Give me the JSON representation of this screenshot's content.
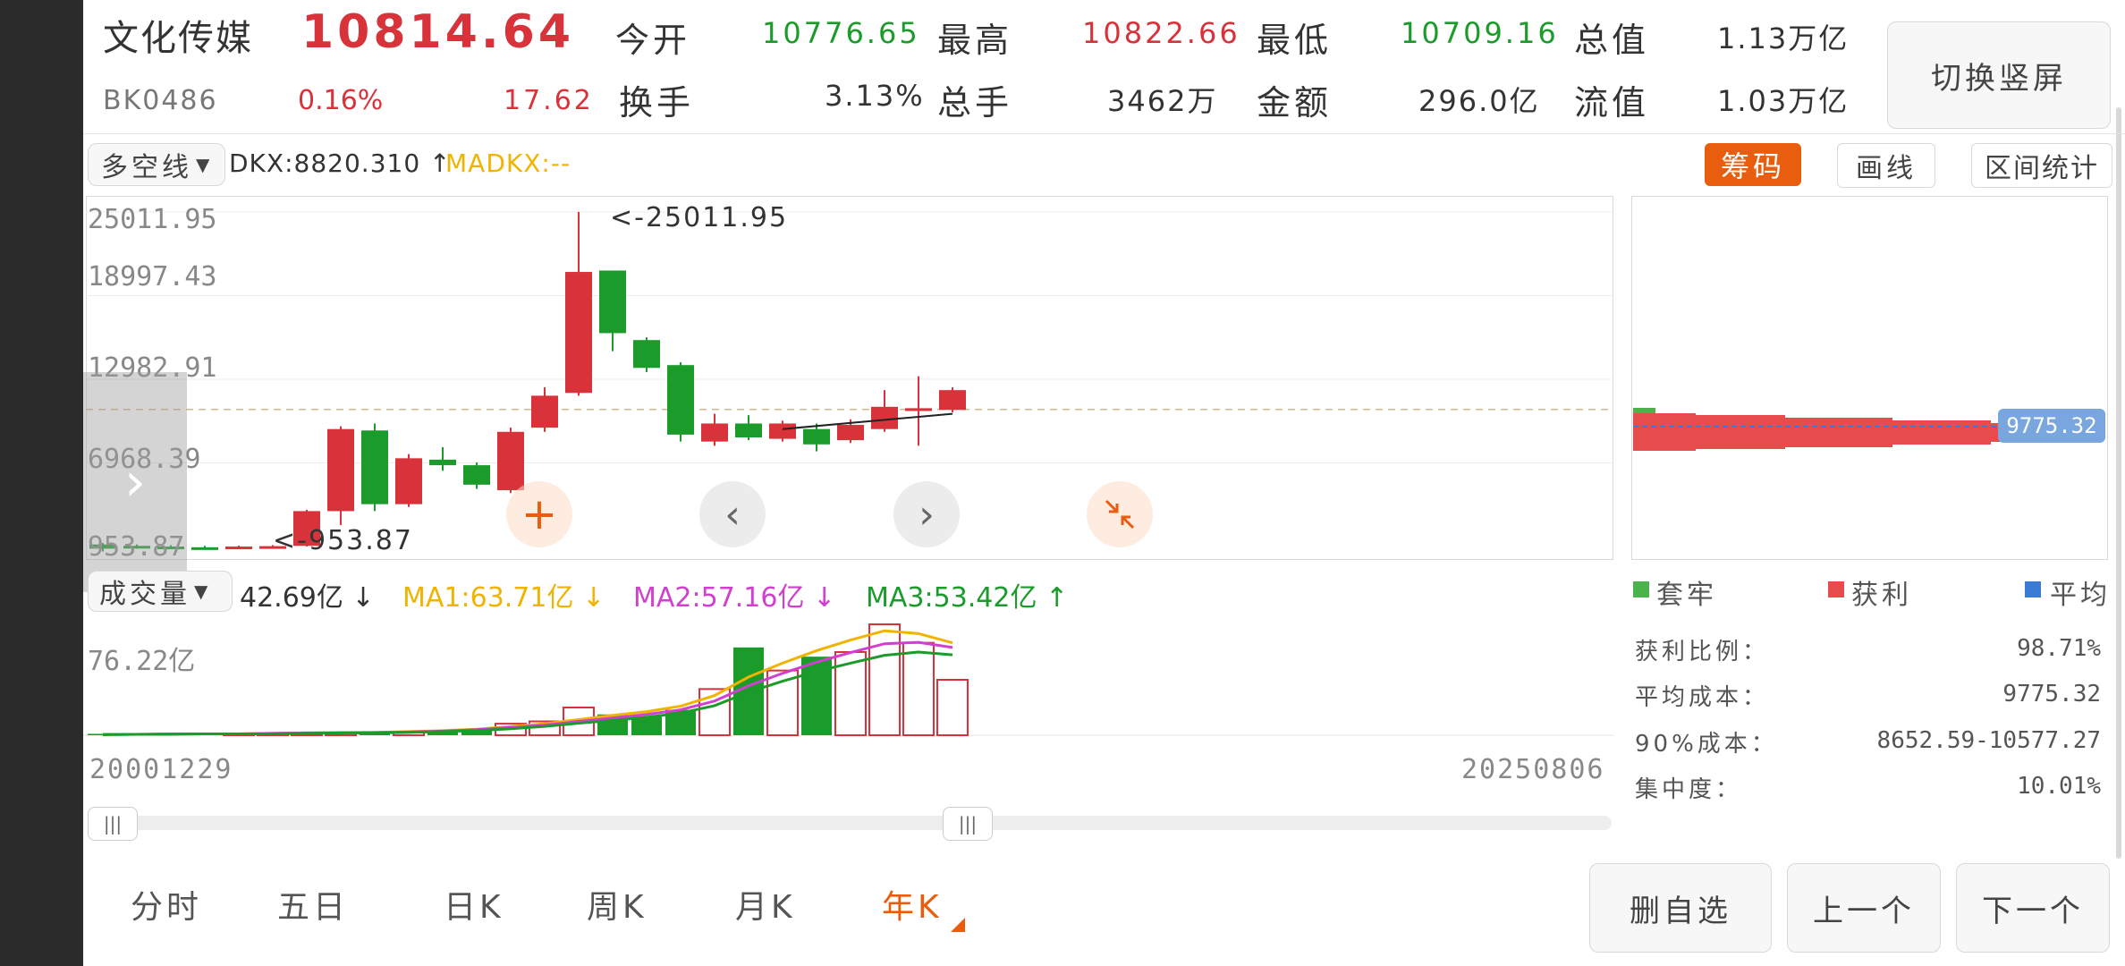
{
  "header": {
    "name": "文化传媒",
    "code": "BK0486",
    "price": "10814.64",
    "change_pct": "0.16%",
    "change": "17.62",
    "open_label": "今开",
    "open_value": "10776.65",
    "high_label": "最高",
    "high_value": "10822.66",
    "low_label": "最低",
    "low_value": "10709.16",
    "mktcap_label": "总值",
    "mktcap_value": "1.13万亿",
    "turnover_label": "换手",
    "turnover_value": "3.13%",
    "volume_label": "总手",
    "volume_value": "3462万",
    "amount_label": "金额",
    "amount_value": "296.0亿",
    "float_label": "流值",
    "float_value": "1.03万亿",
    "switch_button": "切换竖屏"
  },
  "indicator": {
    "selector": "多空线",
    "dkx": "DKX:8820.310 ↑",
    "madkx": "MADKX:--",
    "chip_button": "筹码",
    "draw_button": "画线",
    "range_button": "区间统计"
  },
  "price_axis": {
    "max_marker": "<-25011.95",
    "min_marker": "<-953.87",
    "ticks": [
      "25011.95",
      "18997.43",
      "12982.91",
      "6968.39",
      "953.87"
    ]
  },
  "volume": {
    "selector": "成交量",
    "value": "42.69亿 ↓",
    "ma1": "MA1:63.71亿 ↓",
    "ma2": "MA2:57.16亿 ↓",
    "ma3": "MA3:53.42亿 ↑",
    "axis_top": "76.22亿",
    "date_start": "20001229",
    "date_end": "20250806"
  },
  "chip": {
    "current_price_tag": "9775.32",
    "legend": [
      "套牢",
      "获利",
      "平均"
    ],
    "stats": [
      {
        "label": "获利比例：",
        "value": "98.71%"
      },
      {
        "label": "平均成本：",
        "value": "9775.32"
      },
      {
        "label": "90%成本：",
        "value": "8652.59-10577.27"
      },
      {
        "label": "集中度：",
        "value": "10.01%"
      }
    ]
  },
  "tabs": [
    "分时",
    "五日",
    "日K",
    "周K",
    "月K",
    "年K"
  ],
  "actions": {
    "delete": "删自选",
    "prev": "上一个",
    "next": "下一个"
  },
  "colors": {
    "up": "#d8323a",
    "down": "#1a9b2a",
    "accent": "#e85d0e",
    "ma1": "#f0b400",
    "ma2": "#d13fd1",
    "ma3": "#1a9b2a"
  },
  "chart_data": {
    "type": "candlestick",
    "period": "yearly",
    "ylim": [
      953.87,
      25011.95
    ],
    "candles": [
      {
        "open": 1100,
        "close": 800,
        "high": 1200,
        "low": 600
      },
      {
        "open": 1000,
        "close": 900,
        "high": 1100,
        "low": 800
      },
      {
        "open": 950,
        "close": 850,
        "high": 1050,
        "low": 800
      },
      {
        "open": 900,
        "close": 880,
        "high": 1000,
        "low": 820
      },
      {
        "open": 880,
        "close": 950,
        "high": 1020,
        "low": 850
      },
      {
        "open": 900,
        "close": 980,
        "high": 1050,
        "low": 850
      },
      {
        "open": 1000,
        "close": 3500,
        "high": 3600,
        "low": 953.87
      },
      {
        "open": 3500,
        "close": 9400,
        "high": 9600,
        "low": 2500
      },
      {
        "open": 9300,
        "close": 4000,
        "high": 9800,
        "low": 3500
      },
      {
        "open": 4000,
        "close": 7300,
        "high": 7600,
        "low": 3800
      },
      {
        "open": 7200,
        "close": 6800,
        "high": 8100,
        "low": 6400
      },
      {
        "open": 6800,
        "close": 5400,
        "high": 7000,
        "low": 5100
      },
      {
        "open": 5000,
        "close": 9200,
        "high": 9500,
        "low": 4800
      },
      {
        "open": 9500,
        "close": 11800,
        "high": 12400,
        "low": 9200
      },
      {
        "open": 12000,
        "close": 20700,
        "high": 25011.95,
        "low": 11800
      },
      {
        "open": 20800,
        "close": 16300,
        "high": 20800,
        "low": 15000
      },
      {
        "open": 15800,
        "close": 13800,
        "high": 16000,
        "low": 13500
      },
      {
        "open": 14000,
        "close": 9000,
        "high": 14200,
        "low": 8500
      },
      {
        "open": 8500,
        "close": 9800,
        "high": 10500,
        "low": 8200
      },
      {
        "open": 9800,
        "close": 8800,
        "high": 10400,
        "low": 8600
      },
      {
        "open": 8700,
        "close": 9800,
        "high": 10000,
        "low": 8500
      },
      {
        "open": 9400,
        "close": 8300,
        "high": 9800,
        "low": 7800
      },
      {
        "open": 8600,
        "close": 9700,
        "high": 10100,
        "low": 8400
      },
      {
        "open": 9400,
        "close": 11000,
        "high": 12200,
        "low": 9200
      },
      {
        "open": 10700,
        "close": 10900,
        "high": 13200,
        "low": 8200
      },
      {
        "open": 10776.65,
        "close": 12200,
        "high": 12400,
        "low": 10600
      }
    ],
    "volumes": [
      0.3,
      0.3,
      0.5,
      0.4,
      0.3,
      0.3,
      0.3,
      0.5,
      0.5,
      0.6,
      0.7,
      1.2,
      2.5,
      3.0,
      6.0,
      4.5,
      4.0,
      5.5,
      10.0,
      19.0,
      14.0,
      17.0,
      18.0,
      24.0,
      20.0,
      12.0
    ],
    "ma_lines": {
      "MA1": [
        0.2,
        0.2,
        0.3,
        0.3,
        0.3,
        0.4,
        0.5,
        0.6,
        0.6,
        0.8,
        1.0,
        1.3,
        1.9,
        2.5,
        3.4,
        4.3,
        5.1,
        6.3,
        8.6,
        12.6,
        15.6,
        18.3,
        20.6,
        22.6,
        22.0,
        20.0
      ],
      "MA2": [
        0.2,
        0.2,
        0.3,
        0.3,
        0.3,
        0.4,
        0.5,
        0.5,
        0.6,
        0.7,
        0.9,
        1.2,
        1.7,
        2.2,
        3.0,
        3.7,
        4.5,
        5.5,
        7.4,
        10.7,
        13.4,
        15.8,
        17.9,
        19.8,
        20.1,
        19.0
      ],
      "MA3": [
        0.1,
        0.2,
        0.2,
        0.3,
        0.3,
        0.3,
        0.4,
        0.5,
        0.5,
        0.6,
        0.8,
        1.0,
        1.4,
        1.9,
        2.6,
        3.2,
        3.9,
        4.8,
        6.4,
        9.3,
        11.7,
        13.8,
        15.6,
        17.3,
        18.0,
        17.4
      ]
    }
  }
}
